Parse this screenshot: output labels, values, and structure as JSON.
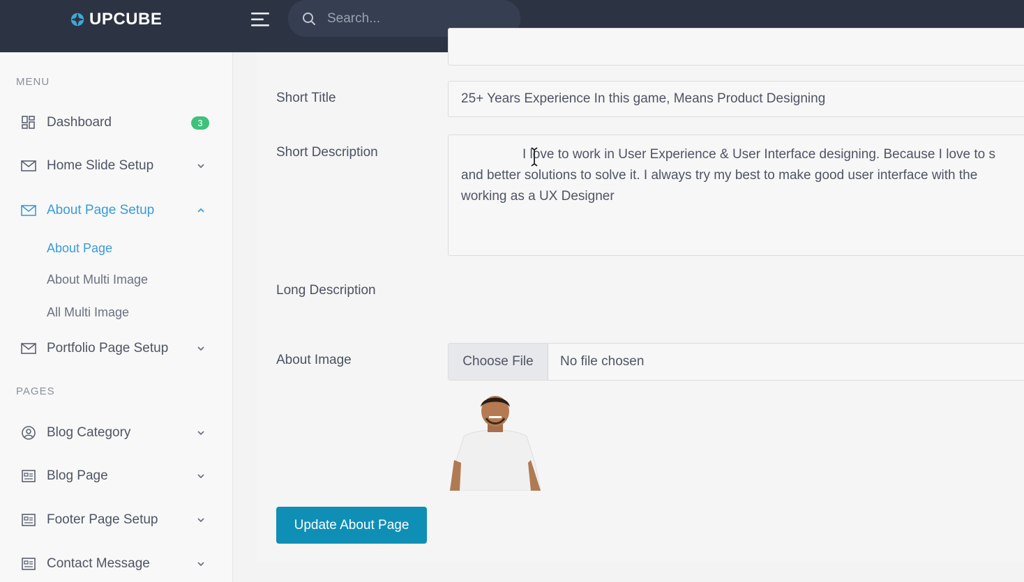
{
  "brand": {
    "name": "UPCUBE"
  },
  "search": {
    "placeholder": "Search..."
  },
  "sidebar": {
    "menu_title": "MENU",
    "pages_title": "PAGES",
    "dashboard": {
      "label": "Dashboard",
      "badge": "3"
    },
    "home_slide": {
      "label": "Home Slide Setup"
    },
    "about_setup": {
      "label": "About Page Setup",
      "children": [
        "About Page",
        "About Multi Image",
        "All Multi Image"
      ]
    },
    "portfolio": {
      "label": "Portfolio Page Setup"
    },
    "blog_category": {
      "label": "Blog Category"
    },
    "blog_page": {
      "label": "Blog Page"
    },
    "footer_setup": {
      "label": "Footer Page Setup"
    },
    "contact": {
      "label": "Contact Message"
    }
  },
  "form": {
    "short_title_label": "Short Title",
    "short_title_value": "25+ Years Experience In this game, Means Product Designing",
    "short_description_label": "Short Description",
    "short_description_lines": [
      "I love to work in User Experience & User Interface designing. Because I love to s",
      "and better solutions to solve it. I always try my best to make good user interface with the",
      "working as a UX Designer"
    ],
    "long_description_label": "Long Description",
    "about_image_label": "About Image",
    "choose_file_label": "Choose File",
    "file_status": "No file chosen",
    "submit_label": "Update About Page"
  },
  "colors": {
    "topbar": "#2c3444",
    "accent": "#3a9bd9",
    "button": "#0f8fb5",
    "badge": "#3ec17c"
  }
}
